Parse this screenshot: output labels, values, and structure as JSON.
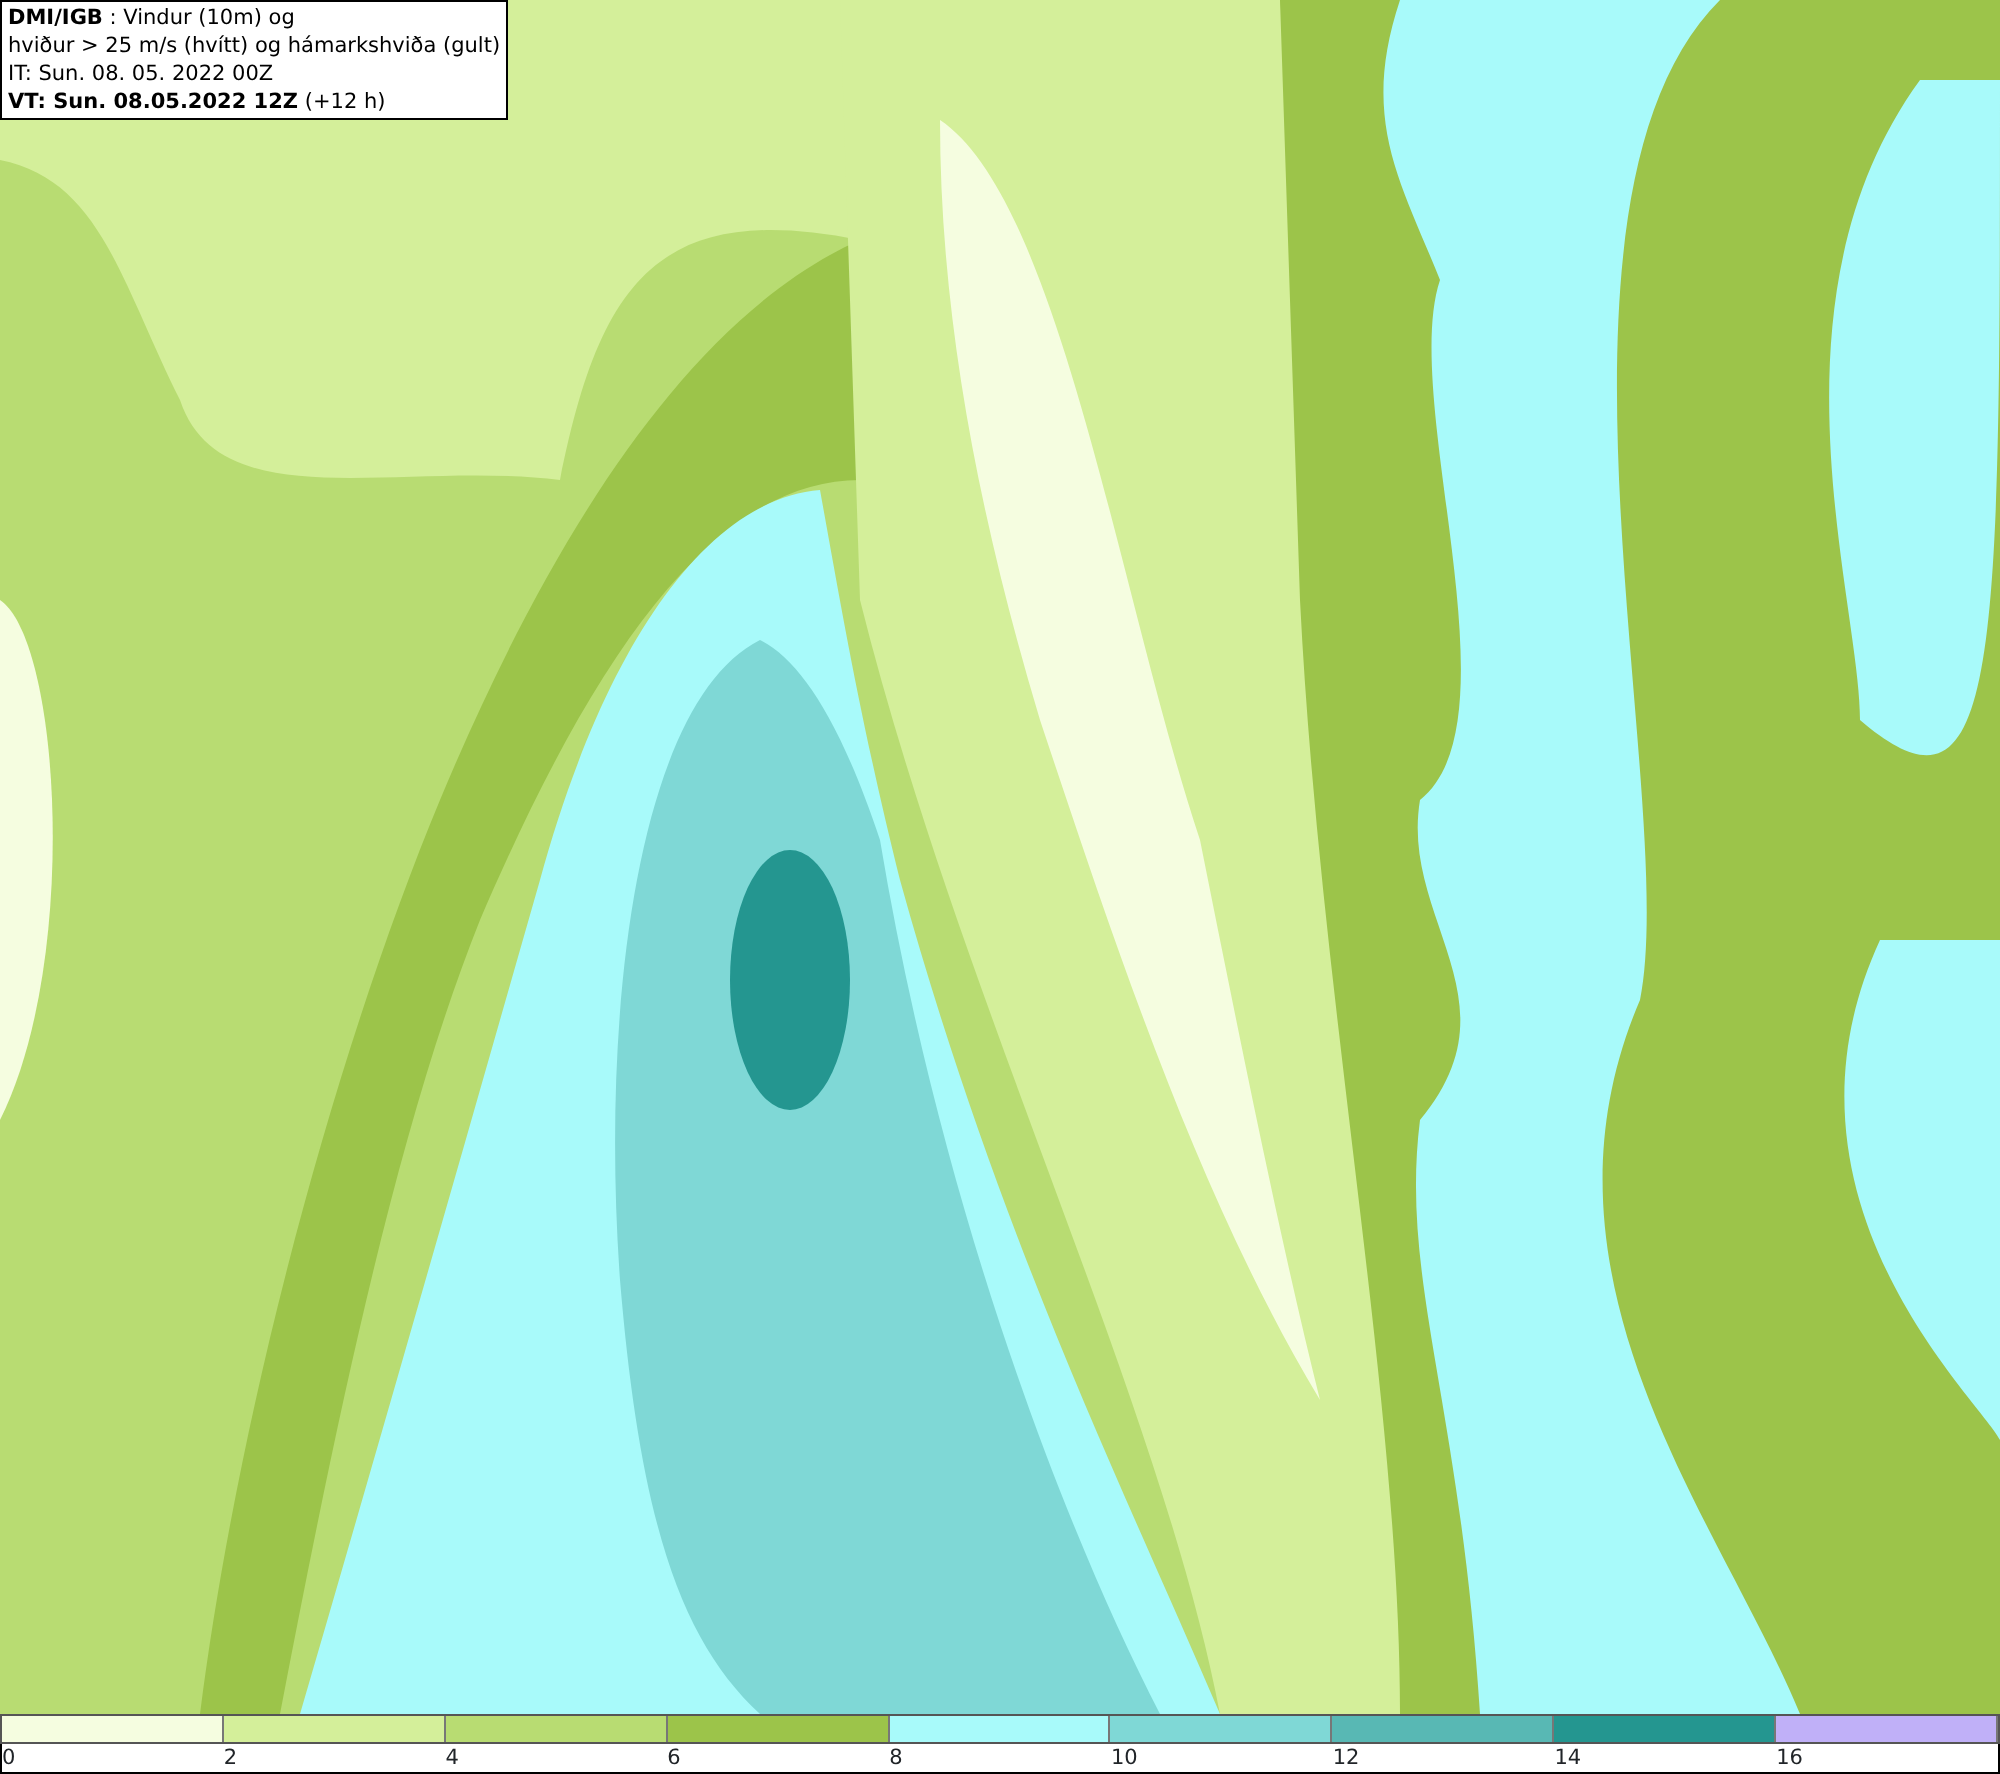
{
  "info_box": {
    "lines": [
      "**DMI/IGB** : Vindur (10m) og",
      "hviður > 25 m/s (hvítt) og hámarkshviða (gult)",
      "IT: Sun. 08. 05. 2022 00Z",
      "**VT: Sun. 08.05.2022 12Z** (+12 h)"
    ]
  },
  "legend": {
    "bins": [
      {
        "label": "0",
        "color": "#f5fde0"
      },
      {
        "label": "2",
        "color": "#d4ef9a"
      },
      {
        "label": "4",
        "color": "#b8dc72"
      },
      {
        "label": "6",
        "color": "#9cc44a"
      },
      {
        "label": "8",
        "color": "#a8fafa"
      },
      {
        "label": "10",
        "color": "#7fd8d6"
      },
      {
        "label": "12",
        "color": "#58b8b4"
      },
      {
        "label": "14",
        "color": "#249690"
      },
      {
        "label": "16",
        "color": "#c0b0f8"
      }
    ]
  }
}
